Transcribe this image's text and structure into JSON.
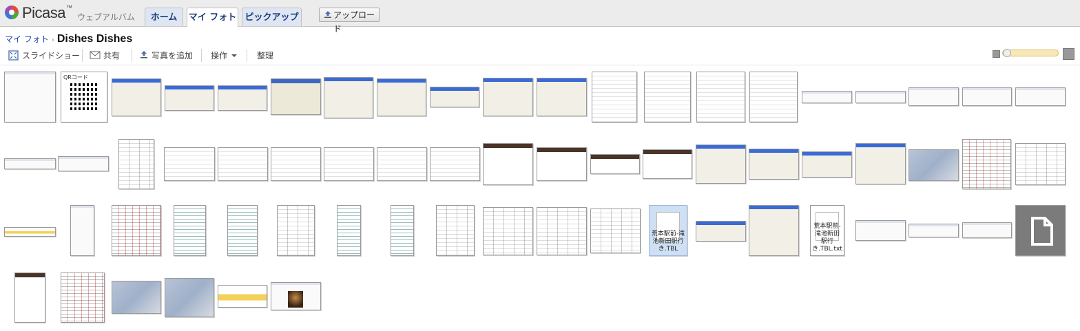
{
  "header": {
    "brand": "Picasa",
    "brand_tm": "™",
    "brand_sub": "ウェブアルバム",
    "tabs": [
      {
        "label": "ホーム",
        "active": false
      },
      {
        "label": "マイ フォト",
        "active": true
      },
      {
        "label": "ピックアップ",
        "active": false
      }
    ],
    "upload_label": "アップロード"
  },
  "breadcrumb": {
    "root": "マイ フォト",
    "separator": "›",
    "album_title": "Dishes Dishes"
  },
  "toolbar": {
    "slideshow": "スライドショー",
    "share": "共有",
    "add_photos": "写真を追加",
    "actions": "操作",
    "organize": "整理"
  },
  "thumbnails": {
    "qr_label": "QRコード",
    "file1_name": "荒本駅前-滝池新田駅行き.TBL",
    "file2_name": "荒本駅前-滝池新田駅行き.TBL.txt"
  },
  "colors": {
    "accent_link": "#1a3fa8",
    "tab_text": "#1c3b78",
    "zoom_track": "#f6e8b7"
  }
}
